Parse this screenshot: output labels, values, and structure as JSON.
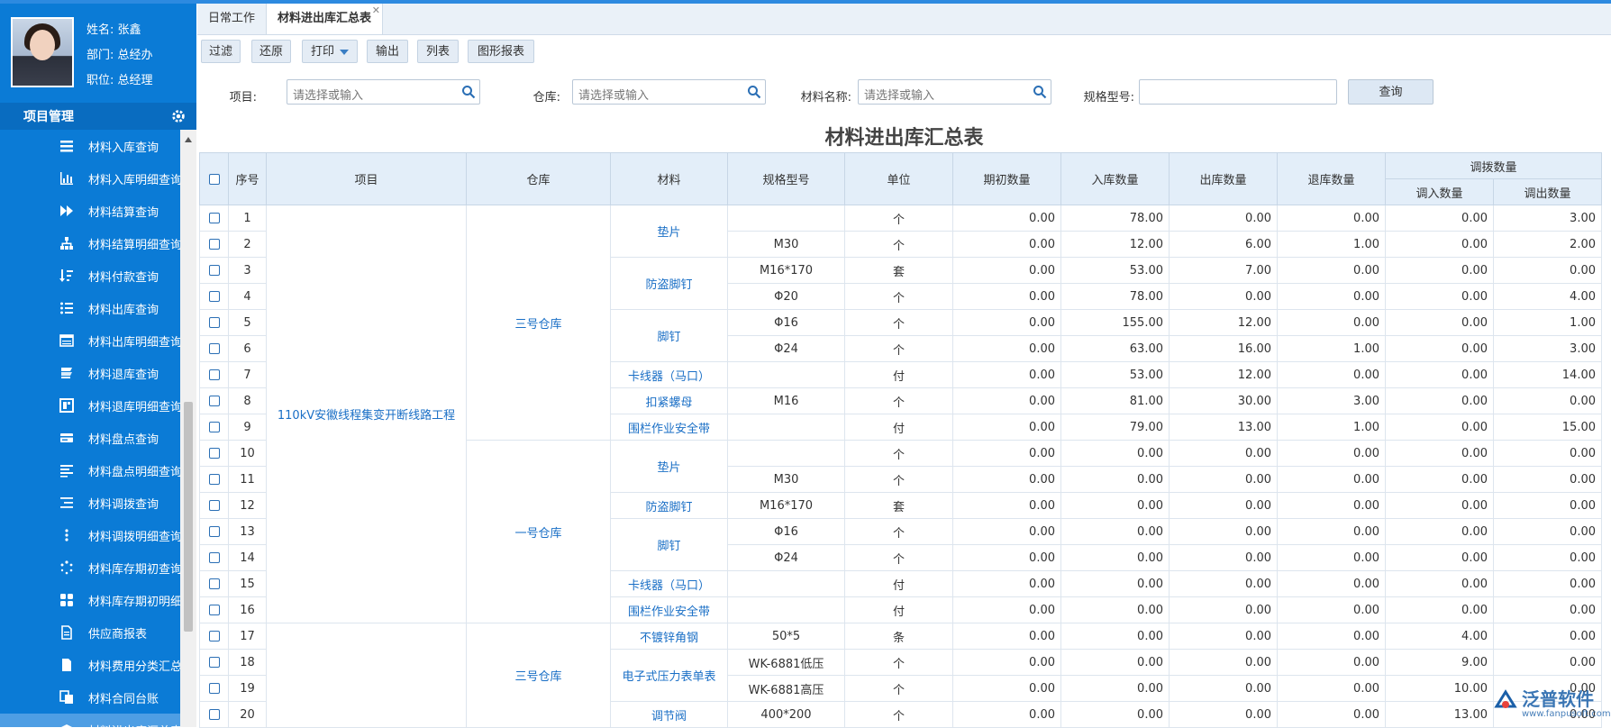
{
  "user": {
    "name": "姓名: 张鑫",
    "dept": "部门: 总经办",
    "role": "职位: 总经理"
  },
  "section": {
    "title": "项目管理"
  },
  "menu": [
    {
      "label": "材料入库查询",
      "icon": "list-icon"
    },
    {
      "label": "材料入库明细查询",
      "icon": "bar-chart-icon"
    },
    {
      "label": "材料结算查询",
      "icon": "fast-forward-icon"
    },
    {
      "label": "材料结算明细查询",
      "icon": "org-chart-icon"
    },
    {
      "label": "材料付款查询",
      "icon": "sort-icon"
    },
    {
      "label": "材料出库查询",
      "icon": "bullet-list-icon"
    },
    {
      "label": "材料出库明细查询",
      "icon": "table-icon"
    },
    {
      "label": "材料退库查询",
      "icon": "stack-icon"
    },
    {
      "label": "材料退库明细查询",
      "icon": "layout-icon"
    },
    {
      "label": "材料盘点查询",
      "icon": "card-icon"
    },
    {
      "label": "材料盘点明细查询",
      "icon": "align-left-icon"
    },
    {
      "label": "材料调拨查询",
      "icon": "indent-list-icon"
    },
    {
      "label": "材料调拨明细查询",
      "icon": "vertical-dots-icon"
    },
    {
      "label": "材料库存期初查询",
      "icon": "spinner-icon"
    },
    {
      "label": "材料库存期初明细",
      "icon": "grid-icon"
    },
    {
      "label": "供应商报表",
      "icon": "document-icon"
    },
    {
      "label": "材料费用分类汇总",
      "icon": "file-icon"
    },
    {
      "label": "材料合同台账",
      "icon": "copy-icon"
    },
    {
      "label": "材料进出库汇总表",
      "icon": "box-icon"
    }
  ],
  "tabs": [
    {
      "label": "日常工作"
    },
    {
      "label": "材料进出库汇总表"
    }
  ],
  "toolbar": {
    "filter": "过滤",
    "restore": "还原",
    "print": "打印",
    "export": "输出",
    "list": "列表",
    "chart": "图形报表"
  },
  "filters": {
    "project_label": "项目:",
    "project_ph": "请选择或输入",
    "warehouse_label": "仓库:",
    "warehouse_ph": "请选择或输入",
    "material_label": "材料名称:",
    "material_ph": "请选择或输入",
    "spec_label": "规格型号:",
    "query": "查询"
  },
  "report_title": "材料进出库汇总表",
  "table": {
    "headers": {
      "seq": "序号",
      "project": "项目",
      "warehouse": "仓库",
      "material": "材料",
      "spec": "规格型号",
      "unit": "单位",
      "opening": "期初数量",
      "in": "入库数量",
      "out": "出库数量",
      "return": "退库数量",
      "transfer": "调拨数量",
      "transfer_in": "调入数量",
      "transfer_out": "调出数量"
    },
    "project_1": "110kV安徽线程集变开断线路工程",
    "warehouses": [
      "三号仓库",
      "一号仓库",
      "三号仓库"
    ],
    "materials": [
      "垫片",
      "防盗脚钉",
      "脚钉",
      "卡线器（马口）",
      "扣紧螺母",
      "围栏作业安全带",
      "垫片",
      "防盗脚钉",
      "脚钉",
      "卡线器（马口）",
      "围栏作业安全带",
      "不镀锌角钢",
      "电子式压力表单表",
      "调节阀"
    ],
    "rows": [
      {
        "seq": "1",
        "spec": "",
        "unit": "个",
        "opening": "0.00",
        "in": "78.00",
        "out": "0.00",
        "ret": "0.00",
        "tin": "0.00",
        "tout": "3.00"
      },
      {
        "seq": "2",
        "spec": "M30",
        "unit": "个",
        "opening": "0.00",
        "in": "12.00",
        "out": "6.00",
        "ret": "1.00",
        "tin": "0.00",
        "tout": "2.00"
      },
      {
        "seq": "3",
        "spec": "M16*170",
        "unit": "套",
        "opening": "0.00",
        "in": "53.00",
        "out": "7.00",
        "ret": "0.00",
        "tin": "0.00",
        "tout": "0.00"
      },
      {
        "seq": "4",
        "spec": "Φ20",
        "unit": "个",
        "opening": "0.00",
        "in": "78.00",
        "out": "0.00",
        "ret": "0.00",
        "tin": "0.00",
        "tout": "4.00"
      },
      {
        "seq": "5",
        "spec": "Φ16",
        "unit": "个",
        "opening": "0.00",
        "in": "155.00",
        "out": "12.00",
        "ret": "0.00",
        "tin": "0.00",
        "tout": "1.00"
      },
      {
        "seq": "6",
        "spec": "Φ24",
        "unit": "个",
        "opening": "0.00",
        "in": "63.00",
        "out": "16.00",
        "ret": "1.00",
        "tin": "0.00",
        "tout": "3.00"
      },
      {
        "seq": "7",
        "spec": "",
        "unit": "付",
        "opening": "0.00",
        "in": "53.00",
        "out": "12.00",
        "ret": "0.00",
        "tin": "0.00",
        "tout": "14.00"
      },
      {
        "seq": "8",
        "spec": "M16",
        "unit": "个",
        "opening": "0.00",
        "in": "81.00",
        "out": "30.00",
        "ret": "3.00",
        "tin": "0.00",
        "tout": "0.00"
      },
      {
        "seq": "9",
        "spec": "",
        "unit": "付",
        "opening": "0.00",
        "in": "79.00",
        "out": "13.00",
        "ret": "1.00",
        "tin": "0.00",
        "tout": "15.00"
      },
      {
        "seq": "10",
        "spec": "",
        "unit": "个",
        "opening": "0.00",
        "in": "0.00",
        "out": "0.00",
        "ret": "0.00",
        "tin": "0.00",
        "tout": "0.00"
      },
      {
        "seq": "11",
        "spec": "M30",
        "unit": "个",
        "opening": "0.00",
        "in": "0.00",
        "out": "0.00",
        "ret": "0.00",
        "tin": "0.00",
        "tout": "0.00"
      },
      {
        "seq": "12",
        "spec": "M16*170",
        "unit": "套",
        "opening": "0.00",
        "in": "0.00",
        "out": "0.00",
        "ret": "0.00",
        "tin": "0.00",
        "tout": "0.00"
      },
      {
        "seq": "13",
        "spec": "Φ16",
        "unit": "个",
        "opening": "0.00",
        "in": "0.00",
        "out": "0.00",
        "ret": "0.00",
        "tin": "0.00",
        "tout": "0.00"
      },
      {
        "seq": "14",
        "spec": "Φ24",
        "unit": "个",
        "opening": "0.00",
        "in": "0.00",
        "out": "0.00",
        "ret": "0.00",
        "tin": "0.00",
        "tout": "0.00"
      },
      {
        "seq": "15",
        "spec": "",
        "unit": "付",
        "opening": "0.00",
        "in": "0.00",
        "out": "0.00",
        "ret": "0.00",
        "tin": "0.00",
        "tout": "0.00"
      },
      {
        "seq": "16",
        "spec": "",
        "unit": "付",
        "opening": "0.00",
        "in": "0.00",
        "out": "0.00",
        "ret": "0.00",
        "tin": "0.00",
        "tout": "0.00"
      },
      {
        "seq": "17",
        "spec": "50*5",
        "unit": "条",
        "opening": "0.00",
        "in": "0.00",
        "out": "0.00",
        "ret": "0.00",
        "tin": "4.00",
        "tout": "0.00"
      },
      {
        "seq": "18",
        "spec": "WK-6881低压",
        "unit": "个",
        "opening": "0.00",
        "in": "0.00",
        "out": "0.00",
        "ret": "0.00",
        "tin": "9.00",
        "tout": "0.00"
      },
      {
        "seq": "19",
        "spec": "WK-6881高压",
        "unit": "个",
        "opening": "0.00",
        "in": "0.00",
        "out": "0.00",
        "ret": "0.00",
        "tin": "10.00",
        "tout": "0.00"
      },
      {
        "seq": "20",
        "spec": "400*200",
        "unit": "个",
        "opening": "0.00",
        "in": "0.00",
        "out": "0.00",
        "ret": "0.00",
        "tin": "13.00",
        "tout": "0.00"
      }
    ]
  },
  "watermark": {
    "text": "泛普软件",
    "url": "www.fanpusoft.com"
  },
  "colors": {
    "sidebar": "#0b7bd6",
    "accent": "#1a6fc6",
    "header_bg": "#e3eef9"
  }
}
